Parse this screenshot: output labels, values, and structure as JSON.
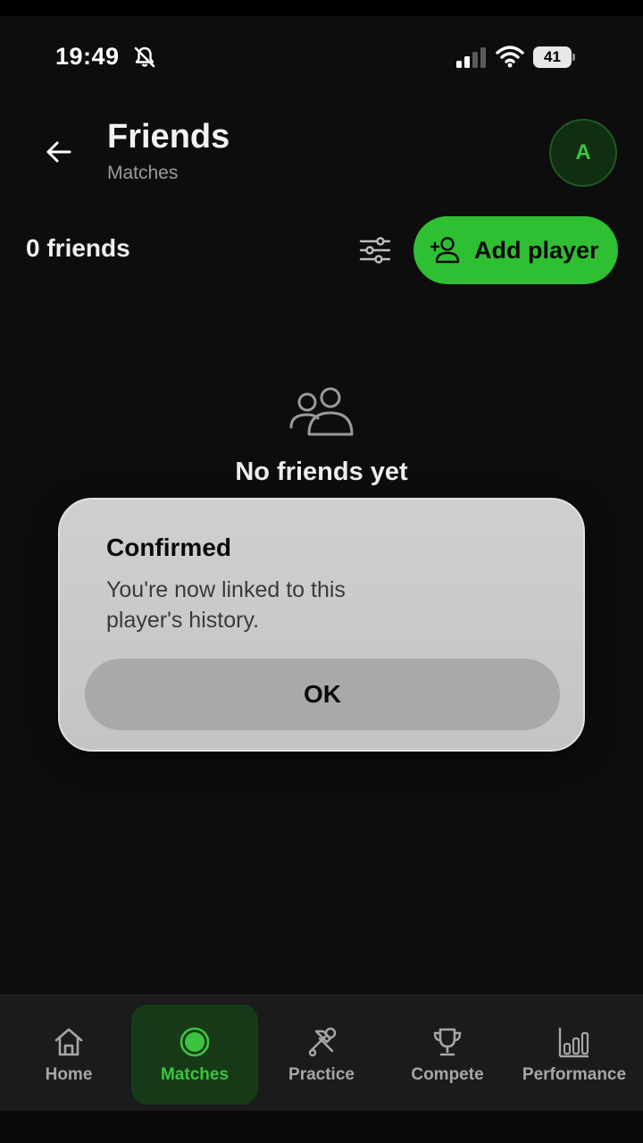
{
  "status_bar": {
    "time": "19:49",
    "battery": "41",
    "icons": [
      "bell-slash-icon",
      "signal-icon",
      "wifi-icon",
      "battery-icon"
    ]
  },
  "header": {
    "title": "Friends",
    "subtitle": "Matches",
    "avatar_initial": "A",
    "back_icon": "arrow-left-icon"
  },
  "friends_row": {
    "count_label": "0 friends",
    "filter_icon": "sliders-icon",
    "add_player_label": "Add player",
    "add_player_icon": "user-plus-icon"
  },
  "empty_state": {
    "icon": "users-icon",
    "text": "No friends yet"
  },
  "alert": {
    "title": "Confirmed",
    "message": "You're now linked to this player's history.",
    "ok_label": "OK"
  },
  "tab_bar": {
    "active": "Matches",
    "tabs": [
      {
        "label": "Home",
        "icon": "home-icon"
      },
      {
        "label": "Matches",
        "icon": "match-circle-icon"
      },
      {
        "label": "Practice",
        "icon": "tools-icon"
      },
      {
        "label": "Compete",
        "icon": "trophy-icon"
      },
      {
        "label": "Performance",
        "icon": "bar-chart-icon"
      }
    ]
  },
  "colors": {
    "background": "#0d0d0d",
    "accent_green": "#2fbf32",
    "active_tab_bg": "#163a18",
    "alert_bg": "#c9c9c9",
    "alert_button": "#a9a9a9"
  }
}
